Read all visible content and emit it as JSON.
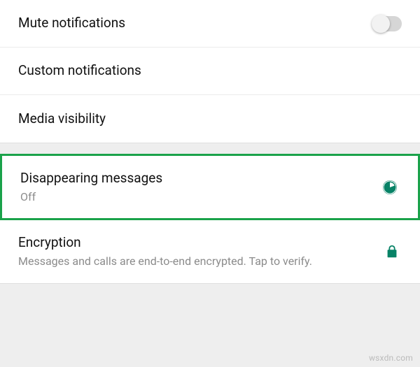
{
  "colors": {
    "accent": "#078266",
    "highlight_border": "#1aa24a"
  },
  "section1": {
    "mute": {
      "title": "Mute notifications",
      "toggled": false
    },
    "custom": {
      "title": "Custom notifications"
    },
    "media": {
      "title": "Media visibility"
    }
  },
  "section2": {
    "disappearing": {
      "title": "Disappearing messages",
      "subtitle": "Off",
      "icon": "timer-icon"
    },
    "encryption": {
      "title": "Encryption",
      "subtitle": "Messages and calls are end-to-end encrypted. Tap to verify.",
      "icon": "lock-icon"
    }
  },
  "watermark": "wsxdn.com"
}
